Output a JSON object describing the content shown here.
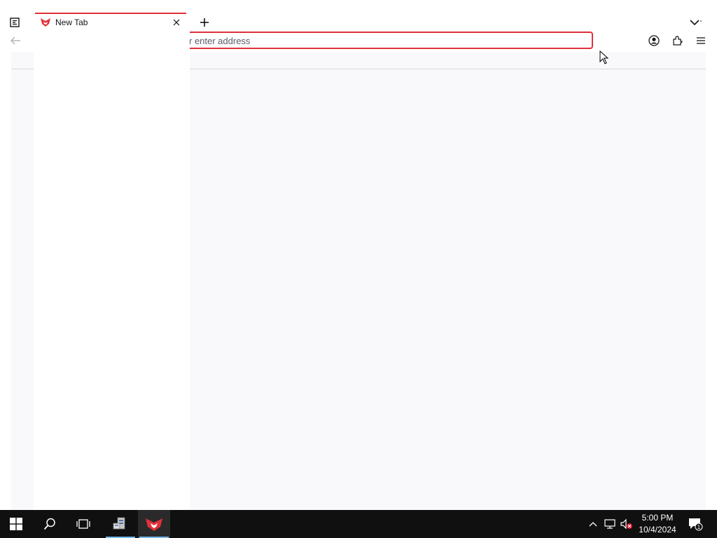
{
  "browser": {
    "tab": {
      "title": "New Tab"
    },
    "urlbar": {
      "placeholder": "Search or enter address",
      "visible_text": "r enter address"
    },
    "accent_color": "#e0313b",
    "content_bg": "#f9f9fb"
  },
  "icons": {
    "sidebar": "sidebar-icon",
    "favicon": "browser-logo-icon",
    "close": "close-icon",
    "new_tab": "plus-icon",
    "tab_list": "chevron-down-icon",
    "back": "back-arrow-icon",
    "account": "account-icon",
    "extensions": "puzzle-piece-icon",
    "menu": "hamburger-menu-icon"
  },
  "taskbar": {
    "clock": {
      "time": "5:00 PM",
      "date": "10/4/2024"
    },
    "notification_count": "1"
  }
}
